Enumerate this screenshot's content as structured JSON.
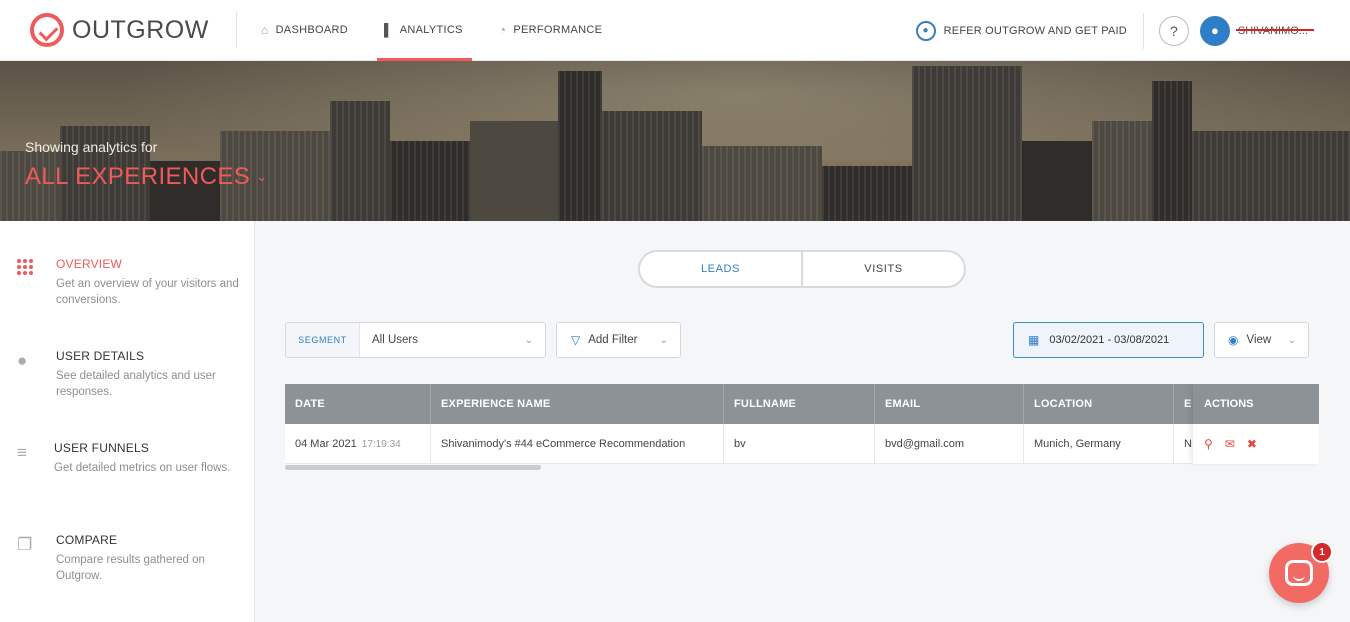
{
  "brand": {
    "name": "OUTGROW"
  },
  "nav": {
    "items": [
      {
        "label": "DASHBOARD",
        "icon": "home-icon"
      },
      {
        "label": "ANALYTICS",
        "icon": "bar-chart-icon"
      },
      {
        "label": "PERFORMANCE",
        "icon": "speedometer-icon"
      }
    ],
    "active": "ANALYTICS"
  },
  "header_right": {
    "refer_label": "REFER OUTGROW AND GET PAID",
    "help_label": "?",
    "username": "SHIVANIMO..."
  },
  "hero": {
    "subtitle": "Showing analytics for",
    "title": "ALL EXPERIENCES"
  },
  "sidebar": {
    "items": [
      {
        "title": "OVERVIEW",
        "desc": "Get an overview of your visitors and conversions.",
        "icon": "grid-dots-icon",
        "active": true
      },
      {
        "title": "USER DETAILS",
        "desc": "See detailed analytics and user responses.",
        "icon": "user-icon"
      },
      {
        "title": "USER FUNNELS",
        "desc": "Get detailed metrics on user flows.",
        "icon": "funnel-lines-icon"
      },
      {
        "title": "COMPARE",
        "desc": "Compare results gathered on Outgrow.",
        "icon": "compare-icon"
      }
    ]
  },
  "tabs": {
    "leads": "LEADS",
    "visits": "VISITS",
    "active": "LEADS"
  },
  "filters": {
    "segment_label": "SEGMENT",
    "segment_value": "All Users",
    "add_filter": "Add Filter",
    "date_range": "03/02/2021 - 03/08/2021",
    "view": "View"
  },
  "table": {
    "columns": [
      "DATE",
      "EXPERIENCE NAME",
      "FULLNAME",
      "EMAIL",
      "LOCATION",
      "E"
    ],
    "actions_header": "ACTIONS",
    "rows": [
      {
        "date": "04 Mar 2021",
        "time": "17:19:34",
        "experience": "Shivanimody's #44 eCommerce Recommendation",
        "fullname": "bv",
        "email": "bvd@gmail.com",
        "location": "Munich, Germany",
        "extra": "N"
      }
    ]
  },
  "chat": {
    "badge": "1"
  },
  "colors": {
    "accent": "#ef5a5a",
    "link": "#2f7fc8",
    "table_header": "#8d9297"
  }
}
